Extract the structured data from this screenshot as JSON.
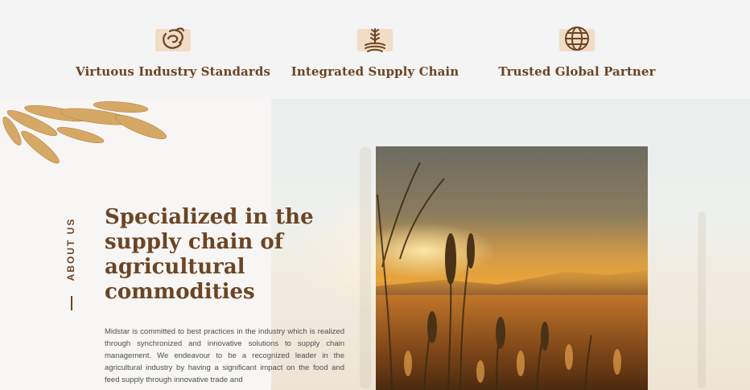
{
  "features": [
    {
      "label": "Virtuous Industry Standards",
      "icon": "handshake-leaf-icon"
    },
    {
      "label": "Integrated Supply Chain",
      "icon": "wheat-field-icon"
    },
    {
      "label": "Trusted Global Partner",
      "icon": "globe-icon"
    }
  ],
  "about": {
    "section_label": "ABOUT US",
    "heading": "Specialized in the supply chain of agricultural commodities",
    "body": "Midstar is committed to best practices in the industry which is realized through synchronized and innovative solutions to supply chain management. We endeavour to be a recognized leader in the agricultural industry by having a significant impact on the food and feed supply through innovative trade and"
  },
  "colors": {
    "brand_brown": "#6b4524",
    "icon_bg": "#f1dcc5",
    "text_gray": "#4f4f4f"
  }
}
